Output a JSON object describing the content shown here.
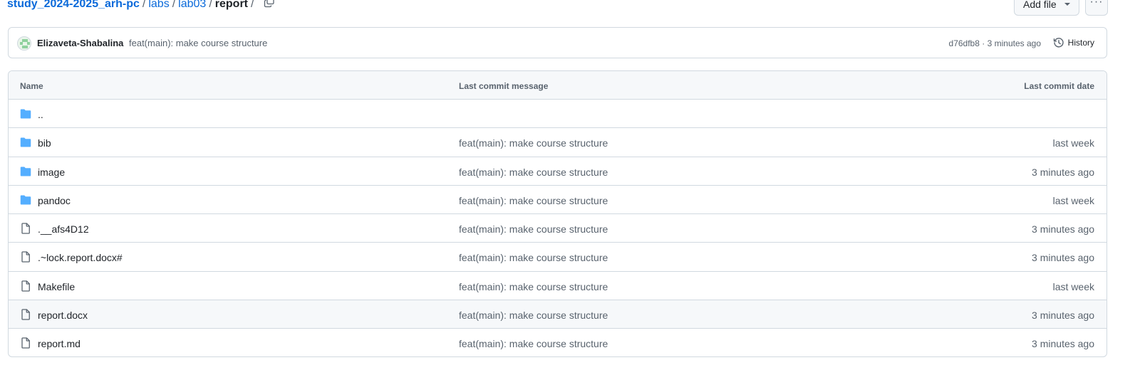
{
  "breadcrumb": {
    "repo": "study_2024-2025_arh-pc",
    "parts": [
      "labs",
      "lab03"
    ],
    "current": "report",
    "separator": "/"
  },
  "actions": {
    "add_file_label": "Add file",
    "more_label": "···"
  },
  "latest_commit": {
    "author": "Elizaveta-Shabalina",
    "message": "feat(main): make course structure",
    "sha": "d76dfb8",
    "meta_separator": "·",
    "time": "3 minutes ago",
    "history_label": "History"
  },
  "table": {
    "headers": {
      "name": "Name",
      "message": "Last commit message",
      "date": "Last commit date"
    },
    "rows": [
      {
        "type": "folder",
        "name": "..",
        "message": "",
        "date": ""
      },
      {
        "type": "folder",
        "name": "bib",
        "message": "feat(main): make course structure",
        "date": "last week"
      },
      {
        "type": "folder",
        "name": "image",
        "message": "feat(main): make course structure",
        "date": "3 minutes ago"
      },
      {
        "type": "folder",
        "name": "pandoc",
        "message": "feat(main): make course structure",
        "date": "last week"
      },
      {
        "type": "file",
        "name": ".__afs4D12",
        "message": "feat(main): make course structure",
        "date": "3 minutes ago"
      },
      {
        "type": "file",
        "name": ".~lock.report.docx#",
        "message": "feat(main): make course structure",
        "date": "3 minutes ago"
      },
      {
        "type": "file",
        "name": "Makefile",
        "message": "feat(main): make course structure",
        "date": "last week"
      },
      {
        "type": "file",
        "name": "report.docx",
        "message": "feat(main): make course structure",
        "date": "3 minutes ago"
      },
      {
        "type": "file",
        "name": "report.md",
        "message": "feat(main): make course structure",
        "date": "3 minutes ago"
      }
    ]
  },
  "icons": {
    "folder": "folder-icon",
    "file": "file-icon",
    "copy": "copy-icon",
    "history": "history-icon"
  },
  "colors": {
    "link": "#0969da",
    "folder": "#54aeff",
    "muted": "#59636e",
    "border": "#d1d9e0"
  }
}
